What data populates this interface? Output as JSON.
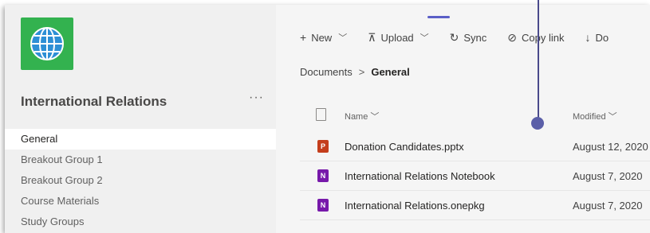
{
  "team": {
    "name": "International Relations",
    "more_label": "···",
    "logo_color": "#33b24f"
  },
  "channels": [
    {
      "label": "General",
      "active": true
    },
    {
      "label": "Breakout Group 1"
    },
    {
      "label": "Breakout Group 2"
    },
    {
      "label": "Course Materials"
    },
    {
      "label": "Study Groups"
    }
  ],
  "toolbar": {
    "new_label": "New",
    "upload_label": "Upload",
    "sync_label": "Sync",
    "copy_link_label": "Copy link",
    "download_label": "Do"
  },
  "breadcrumb": {
    "root": "Documents",
    "current": "General"
  },
  "columns": {
    "name": "Name",
    "modified": "Modified"
  },
  "files": [
    {
      "name": "Donation Candidates.pptx",
      "modified": "August 12, 2020",
      "type": "pptx",
      "icon": "powerpoint-icon"
    },
    {
      "name": "International Relations Notebook",
      "modified": "August 7, 2020",
      "type": "onenote",
      "icon": "onenote-icon"
    },
    {
      "name": "International Relations.onepkg",
      "modified": "August 7, 2020",
      "type": "onenote",
      "icon": "onenote-icon"
    }
  ],
  "colors": {
    "accent": "#5b5fc7",
    "powerpoint": "#c43e1c",
    "onenote": "#7719aa"
  }
}
